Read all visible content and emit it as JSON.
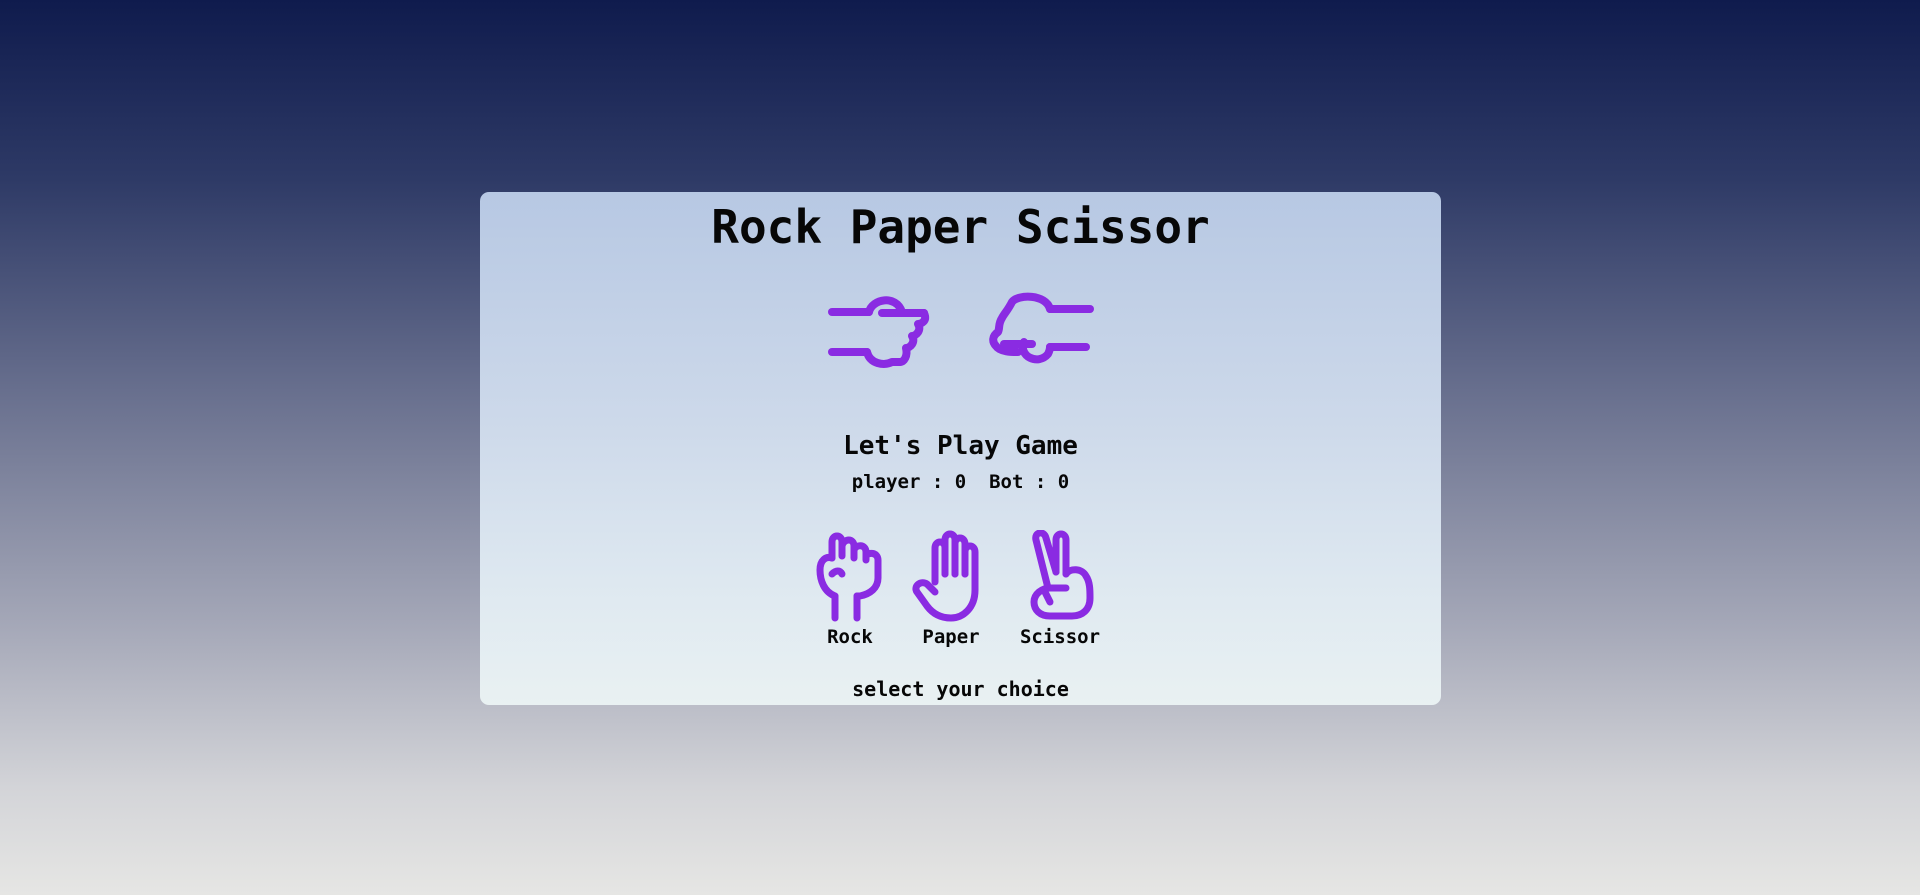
{
  "game": {
    "title": "Rock Paper Scissor",
    "subtitle": "Let's Play Game",
    "score": {
      "player_label": "player : ",
      "player_value": "0",
      "bot_label": "Bot : ",
      "bot_value": "0"
    },
    "choices": [
      {
        "label": "Rock",
        "icon": "rock-hand-icon"
      },
      {
        "label": "Paper",
        "icon": "paper-hand-icon"
      },
      {
        "label": "Scissor",
        "icon": "scissor-hand-icon"
      }
    ],
    "message": "select your choice",
    "duel": {
      "player_icon": "fist-right-icon",
      "bot_icon": "fist-left-icon"
    }
  },
  "colors": {
    "accent": "#8a2be2",
    "text": "#070707"
  }
}
